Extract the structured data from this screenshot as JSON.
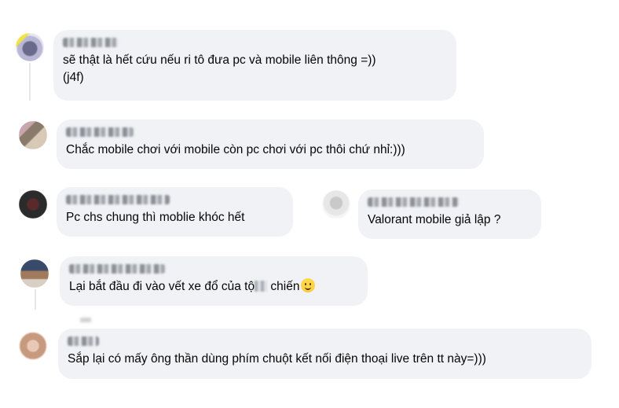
{
  "comments": [
    {
      "text": "sẽ thật là hết cứu nếu ri tô đưa pc và mobile liên thông =))\n(j4f)"
    },
    {
      "text": "Chắc mobile chơi với mobile còn pc chơi với pc thôi chứ nhỉ:)))"
    },
    {
      "text": "Pc chs chung thì moblie khóc hết"
    },
    {
      "text": "Valorant mobile giả lập ?"
    },
    {
      "text_before": "Lại bắt đầu đi vào vết xe đổ của tộ",
      "text_after": " chiến",
      "emoji": "slightly-smiling-face"
    },
    {
      "text": "Sắp lại có mấy ông thần dùng phím chuột kết nối điện thoại live trên tt này=)))"
    }
  ],
  "colors": {
    "bubble": "#f0f2f5",
    "text": "#050505",
    "thread_line": "#e4e6eb"
  }
}
